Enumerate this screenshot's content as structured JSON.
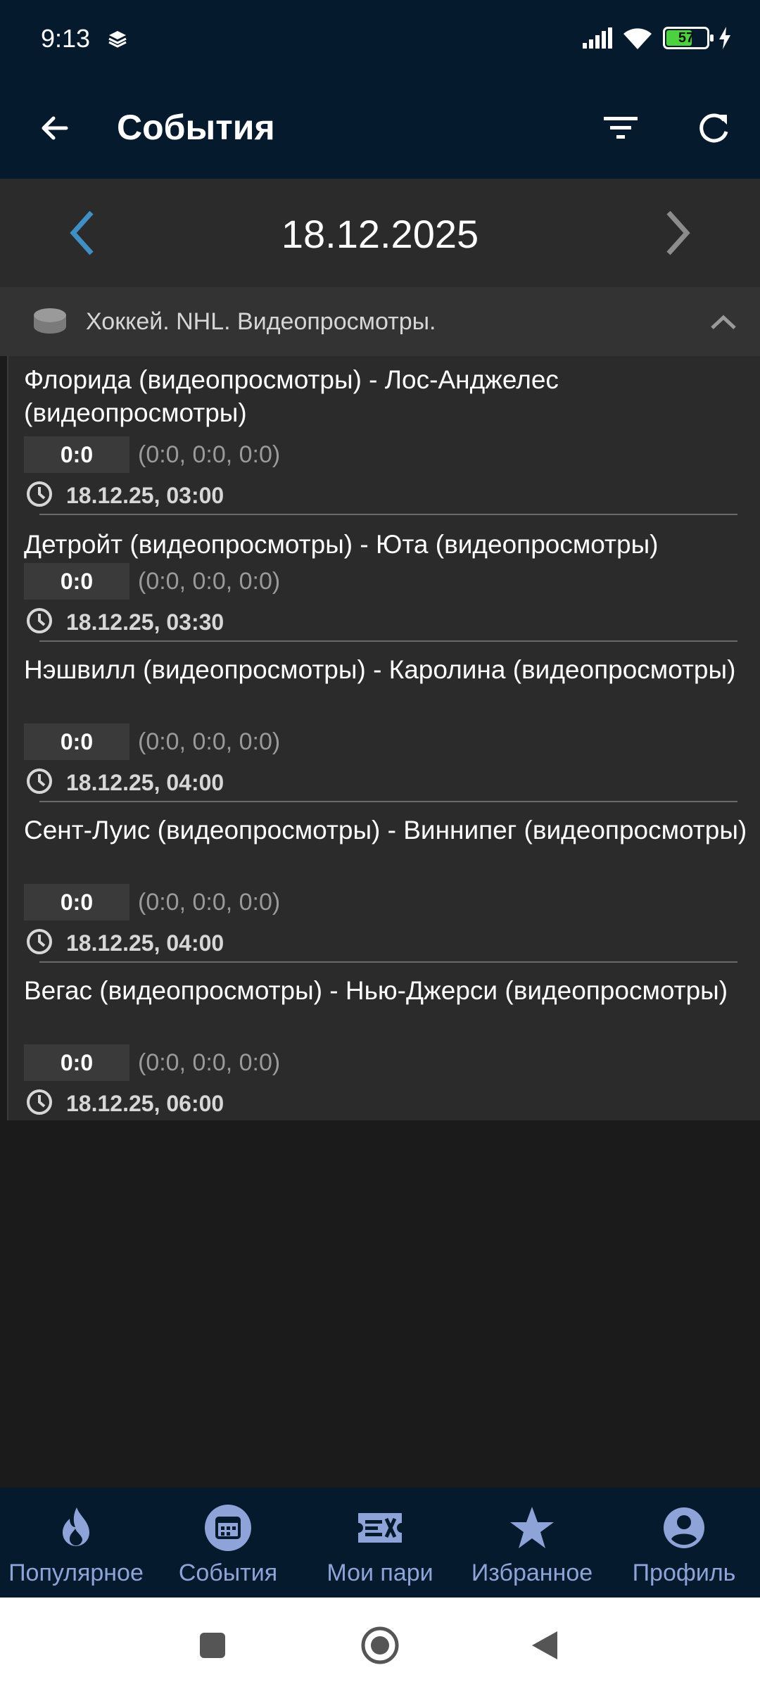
{
  "status_bar": {
    "time": "9:13",
    "battery": "57",
    "icons": [
      "layers-icon",
      "signal-icon",
      "wifi-icon",
      "battery-icon",
      "charging-icon"
    ]
  },
  "app_bar": {
    "title": "События",
    "icons": [
      "back-arrow-icon",
      "filter-icon",
      "refresh-icon"
    ]
  },
  "date_nav": {
    "date": "18.12.2025",
    "icons": [
      "chevron-left-icon",
      "chevron-right-icon"
    ]
  },
  "league": {
    "title": "Хоккей. NHL. Видеопросмотры.",
    "icons": [
      "hockey-puck-icon",
      "chevron-up-icon"
    ]
  },
  "events": [
    {
      "title": "Флорида (видеопросмотры) - Лос-Анджелес (видеопросмотры)",
      "score": "0:0",
      "periods": "(0:0, 0:0, 0:0)",
      "time": "18.12.25, 03:00"
    },
    {
      "title": "Детройт (видеопросмотры) - Юта (видеопросмотры)",
      "score": "0:0",
      "periods": "(0:0, 0:0, 0:0)",
      "time": "18.12.25, 03:30"
    },
    {
      "title": "Нэшвилл (видеопросмотры) - Каролина (видеопросмотры)",
      "score": "0:0",
      "periods": "(0:0, 0:0, 0:0)",
      "time": "18.12.25, 04:00"
    },
    {
      "title": "Сент-Луис (видеопросмотры) - Виннипег (видеопросмотры)",
      "score": "0:0",
      "periods": "(0:0, 0:0, 0:0)",
      "time": "18.12.25, 04:00"
    },
    {
      "title": "Вегас (видеопросмотры) - Нью-Джерси (видеопросмотры)",
      "score": "0:0",
      "periods": "(0:0, 0:0, 0:0)",
      "time": "18.12.25, 06:00"
    }
  ],
  "bottom_nav": {
    "items": [
      {
        "label": "Популярное",
        "icon": "fire-icon"
      },
      {
        "label": "События",
        "icon": "calendar-icon",
        "active": true
      },
      {
        "label": "Мои пари",
        "icon": "ticket-icon"
      },
      {
        "label": "Избранное",
        "icon": "star-icon"
      },
      {
        "label": "Профиль",
        "icon": "profile-icon"
      }
    ]
  },
  "colors": {
    "header_bg": "#051a2c",
    "page_bg": "#1b1b1b",
    "panel_bg": "#2b2b2b",
    "accent": "#3f8fc4",
    "nav_label": "#8ea4d8",
    "battery_fill": "#4cd23f"
  }
}
